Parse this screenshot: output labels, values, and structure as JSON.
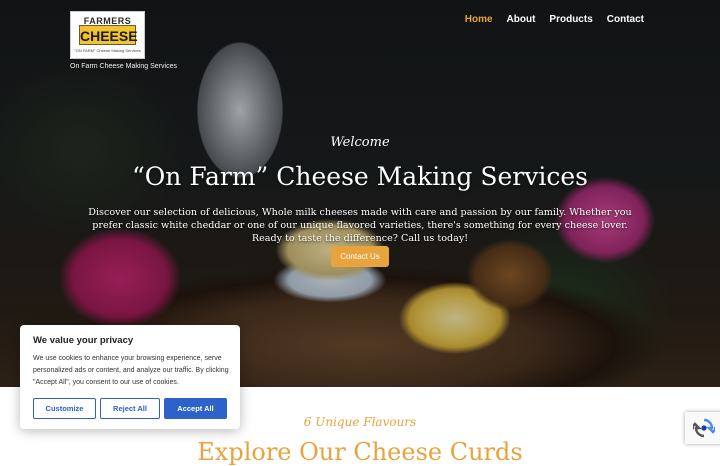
{
  "logo": {
    "line1": "FARMERS",
    "line2": "CHEESE",
    "line3": "\"ON FARM\" Cheese Making Services"
  },
  "tagline": "On Farm Cheese Making Services",
  "nav": {
    "items": [
      {
        "label": "Home",
        "active": true
      },
      {
        "label": "About",
        "active": false
      },
      {
        "label": "Products",
        "active": false
      },
      {
        "label": "Contact",
        "active": false
      }
    ]
  },
  "hero": {
    "welcome": "Welcome",
    "title": "“On Farm” Cheese Making Services",
    "description": "Discover our selection of delicious, Whole milk cheeses made with care and passion by our family. Whether you prefer classic white cheddar or one of our unique flavored varieties, there's something for every cheese lover. Ready to taste the difference? Call us today!",
    "button_label": "Contact Us"
  },
  "section": {
    "subtitle": "6 Unique Flavours",
    "title": "Explore Our Cheese Curds"
  },
  "cookie": {
    "title": "We value your privacy",
    "text": "We use cookies to enhance your browsing experience, serve personalized ads or content, and analyze our traffic. By clicking \"Accept All\", you consent to our use of cookies.",
    "customize_label": "Customize",
    "reject_label": "Reject All",
    "accept_label": "Accept All"
  },
  "colors": {
    "accent": "#e8a33d",
    "cookie_button": "#2c62c9"
  },
  "icons": {
    "recaptcha": "recaptcha-icon"
  }
}
